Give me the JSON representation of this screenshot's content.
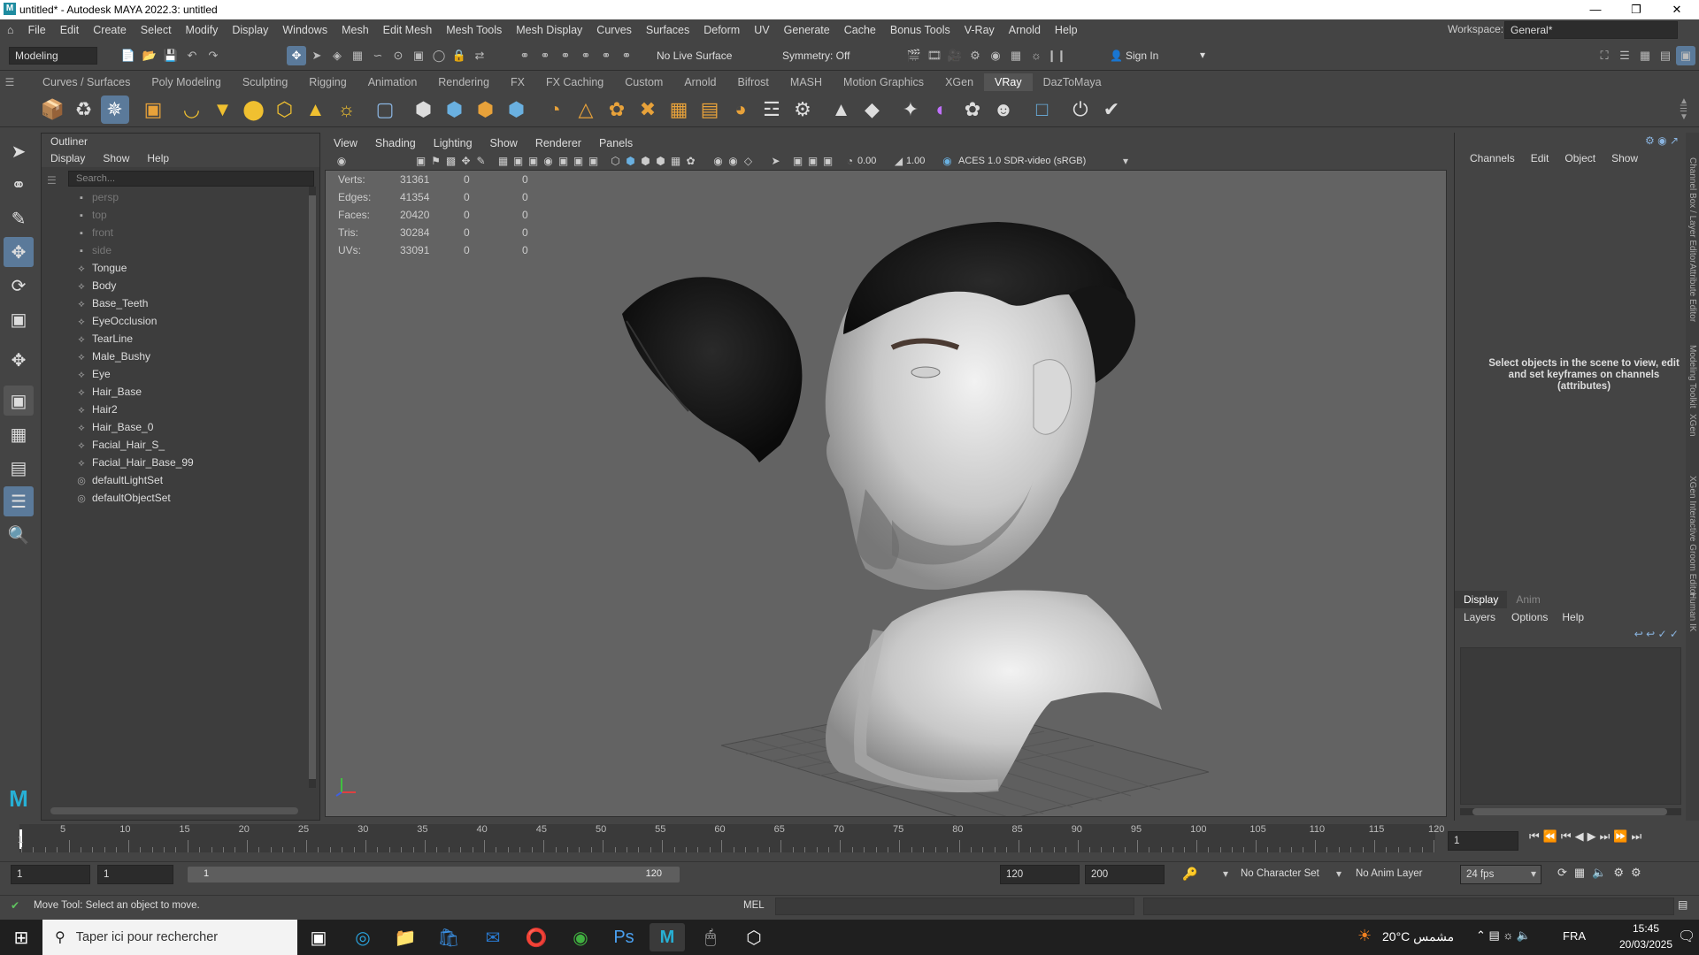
{
  "window": {
    "title": "untitled* - Autodesk MAYA 2022.3: untitled"
  },
  "menu": [
    "File",
    "Edit",
    "Create",
    "Select",
    "Modify",
    "Display",
    "Windows",
    "Mesh",
    "Edit Mesh",
    "Mesh Tools",
    "Mesh Display",
    "Curves",
    "Surfaces",
    "Deform",
    "UV",
    "Generate",
    "Cache",
    "Bonus Tools",
    "V-Ray",
    "Arnold",
    "Help"
  ],
  "workspace": {
    "label": "Workspace:",
    "value": "General*"
  },
  "status_line": {
    "mode": "Modeling",
    "live_surface": "No Live Surface",
    "symmetry": "Symmetry: Off",
    "sign_in": "Sign In"
  },
  "shelf_tabs": [
    "Curves / Surfaces",
    "Poly Modeling",
    "Sculpting",
    "Rigging",
    "Animation",
    "Rendering",
    "FX",
    "FX Caching",
    "Custom",
    "Arnold",
    "Bifrost",
    "MASH",
    "Motion Graphics",
    "XGen",
    "VRay",
    "DazToMaya"
  ],
  "active_shelf": "VRay",
  "outliner": {
    "title": "Outliner",
    "menu": [
      "Display",
      "Show",
      "Help"
    ],
    "search_placeholder": "Search...",
    "items": [
      {
        "label": "persp",
        "icon": "camera-icon",
        "dim": true
      },
      {
        "label": "top",
        "icon": "camera-icon",
        "dim": true
      },
      {
        "label": "front",
        "icon": "camera-icon",
        "dim": true
      },
      {
        "label": "side",
        "icon": "camera-icon",
        "dim": true
      },
      {
        "label": "Tongue",
        "icon": "mesh-icon",
        "dim": false
      },
      {
        "label": "Body",
        "icon": "mesh-icon",
        "dim": false
      },
      {
        "label": "Base_Teeth",
        "icon": "mesh-icon",
        "dim": false
      },
      {
        "label": "EyeOcclusion",
        "icon": "mesh-icon",
        "dim": false
      },
      {
        "label": "TearLine",
        "icon": "mesh-icon",
        "dim": false
      },
      {
        "label": "Male_Bushy",
        "icon": "mesh-icon",
        "dim": false
      },
      {
        "label": "Eye",
        "icon": "mesh-icon",
        "dim": false
      },
      {
        "label": "Hair_Base",
        "icon": "mesh-icon",
        "dim": false
      },
      {
        "label": "Hair2",
        "icon": "mesh-icon",
        "dim": false
      },
      {
        "label": "Hair_Base_0",
        "icon": "mesh-icon",
        "dim": false
      },
      {
        "label": "Facial_Hair_S_",
        "icon": "mesh-icon",
        "dim": false
      },
      {
        "label": "Facial_Hair_Base_99",
        "icon": "mesh-icon",
        "dim": false
      },
      {
        "label": "defaultLightSet",
        "icon": "set-icon",
        "dim": false
      },
      {
        "label": "defaultObjectSet",
        "icon": "set-icon",
        "dim": false
      }
    ]
  },
  "viewport": {
    "menu": [
      "View",
      "Shading",
      "Lighting",
      "Show",
      "Renderer",
      "Panels"
    ],
    "exposure": "0.00",
    "gamma": "1.00",
    "color_space": "ACES 1.0 SDR-video (sRGB)",
    "hud": [
      {
        "k": "Verts:",
        "v1": "31361",
        "v2": "0",
        "v3": "0"
      },
      {
        "k": "Edges:",
        "v1": "41354",
        "v2": "0",
        "v3": "0"
      },
      {
        "k": "Faces:",
        "v1": "20420",
        "v2": "0",
        "v3": "0"
      },
      {
        "k": "Tris:",
        "v1": "30284",
        "v2": "0",
        "v3": "0"
      },
      {
        "k": "UVs:",
        "v1": "33091",
        "v2": "0",
        "v3": "0"
      }
    ]
  },
  "channel_box": {
    "menu": [
      "Channels",
      "Edit",
      "Object",
      "Show"
    ],
    "message": "Select objects in the scene to view, edit and set keyframes on channels (attributes)",
    "layer_tabs": [
      "Display",
      "Anim"
    ],
    "layer_menu": [
      "Layers",
      "Options",
      "Help"
    ]
  },
  "side_tabs": [
    "Channel Box / Layer Editor",
    "Attribute Editor",
    "Modeling Toolkit",
    "XGen",
    "XGen Interactive Groom Editor",
    "Human IK"
  ],
  "timeline": {
    "ticks": [
      "5",
      "10",
      "15",
      "20",
      "25",
      "30",
      "35",
      "40",
      "45",
      "50",
      "55",
      "60",
      "65",
      "70",
      "75",
      "80",
      "85",
      "90",
      "95",
      "100",
      "105",
      "110",
      "115",
      "120"
    ],
    "current_frame": "1"
  },
  "range": {
    "start": "1",
    "anim_start": "1",
    "slider_start": "1",
    "slider_end": "120",
    "end": "120",
    "anim_end": "200",
    "character_set": "No Character Set",
    "anim_layer": "No Anim Layer",
    "fps": "24 fps"
  },
  "help_line": {
    "text": "Move Tool: Select an object to move.",
    "mel": "MEL"
  },
  "taskbar": {
    "search": "Taper ici pour rechercher",
    "weather": "20°C مشمس",
    "lang": "FRA",
    "time": "15:45",
    "date": "20/03/2025"
  }
}
